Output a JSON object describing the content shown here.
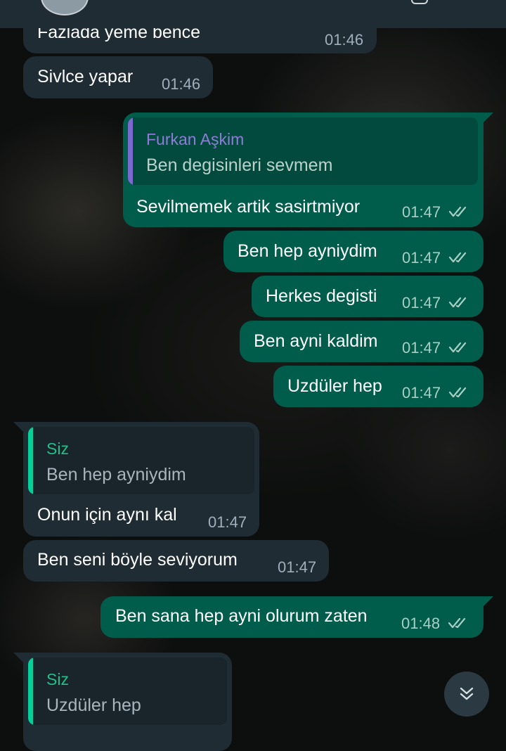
{
  "messages": [
    {
      "text": "Fazlada yeme bence",
      "time": "01:46"
    },
    {
      "text": "Sivlce yapar",
      "time": "01:46"
    },
    {
      "quote_name": "Furkan Aşkim",
      "quote_text": "Ben degisinleri sevmem",
      "text": "Sevilmemek artik sasirtmiyor",
      "time": "01:47"
    },
    {
      "text": "Ben hep ayniydim",
      "time": "01:47"
    },
    {
      "text": "Herkes degisti",
      "time": "01:47"
    },
    {
      "text": "Ben ayni kaldim",
      "time": "01:47"
    },
    {
      "text": "Uzdüler hep",
      "time": "01:47"
    },
    {
      "quote_name": "Siz",
      "quote_text": "Ben hep ayniydim",
      "text": "Onun için aynı kal",
      "time": "01:47"
    },
    {
      "text": "Ben seni böyle seviyorum",
      "time": "01:47"
    },
    {
      "text": "Ben sana hep ayni olurum zaten",
      "time": "01:48"
    },
    {
      "quote_name": "Siz",
      "quote_text": "Uzdüler hep"
    }
  ],
  "icons": {
    "read_receipt": "double-check-icon",
    "scroll_down": "double-chevron-down-icon"
  },
  "colors": {
    "incoming_bubble": "#1f2c34",
    "outgoing_bubble": "#005c4b",
    "read_tick": "#a9cfc5",
    "quote_name_self": "#21c08b",
    "quote_name_other": "#8e7dd6"
  }
}
